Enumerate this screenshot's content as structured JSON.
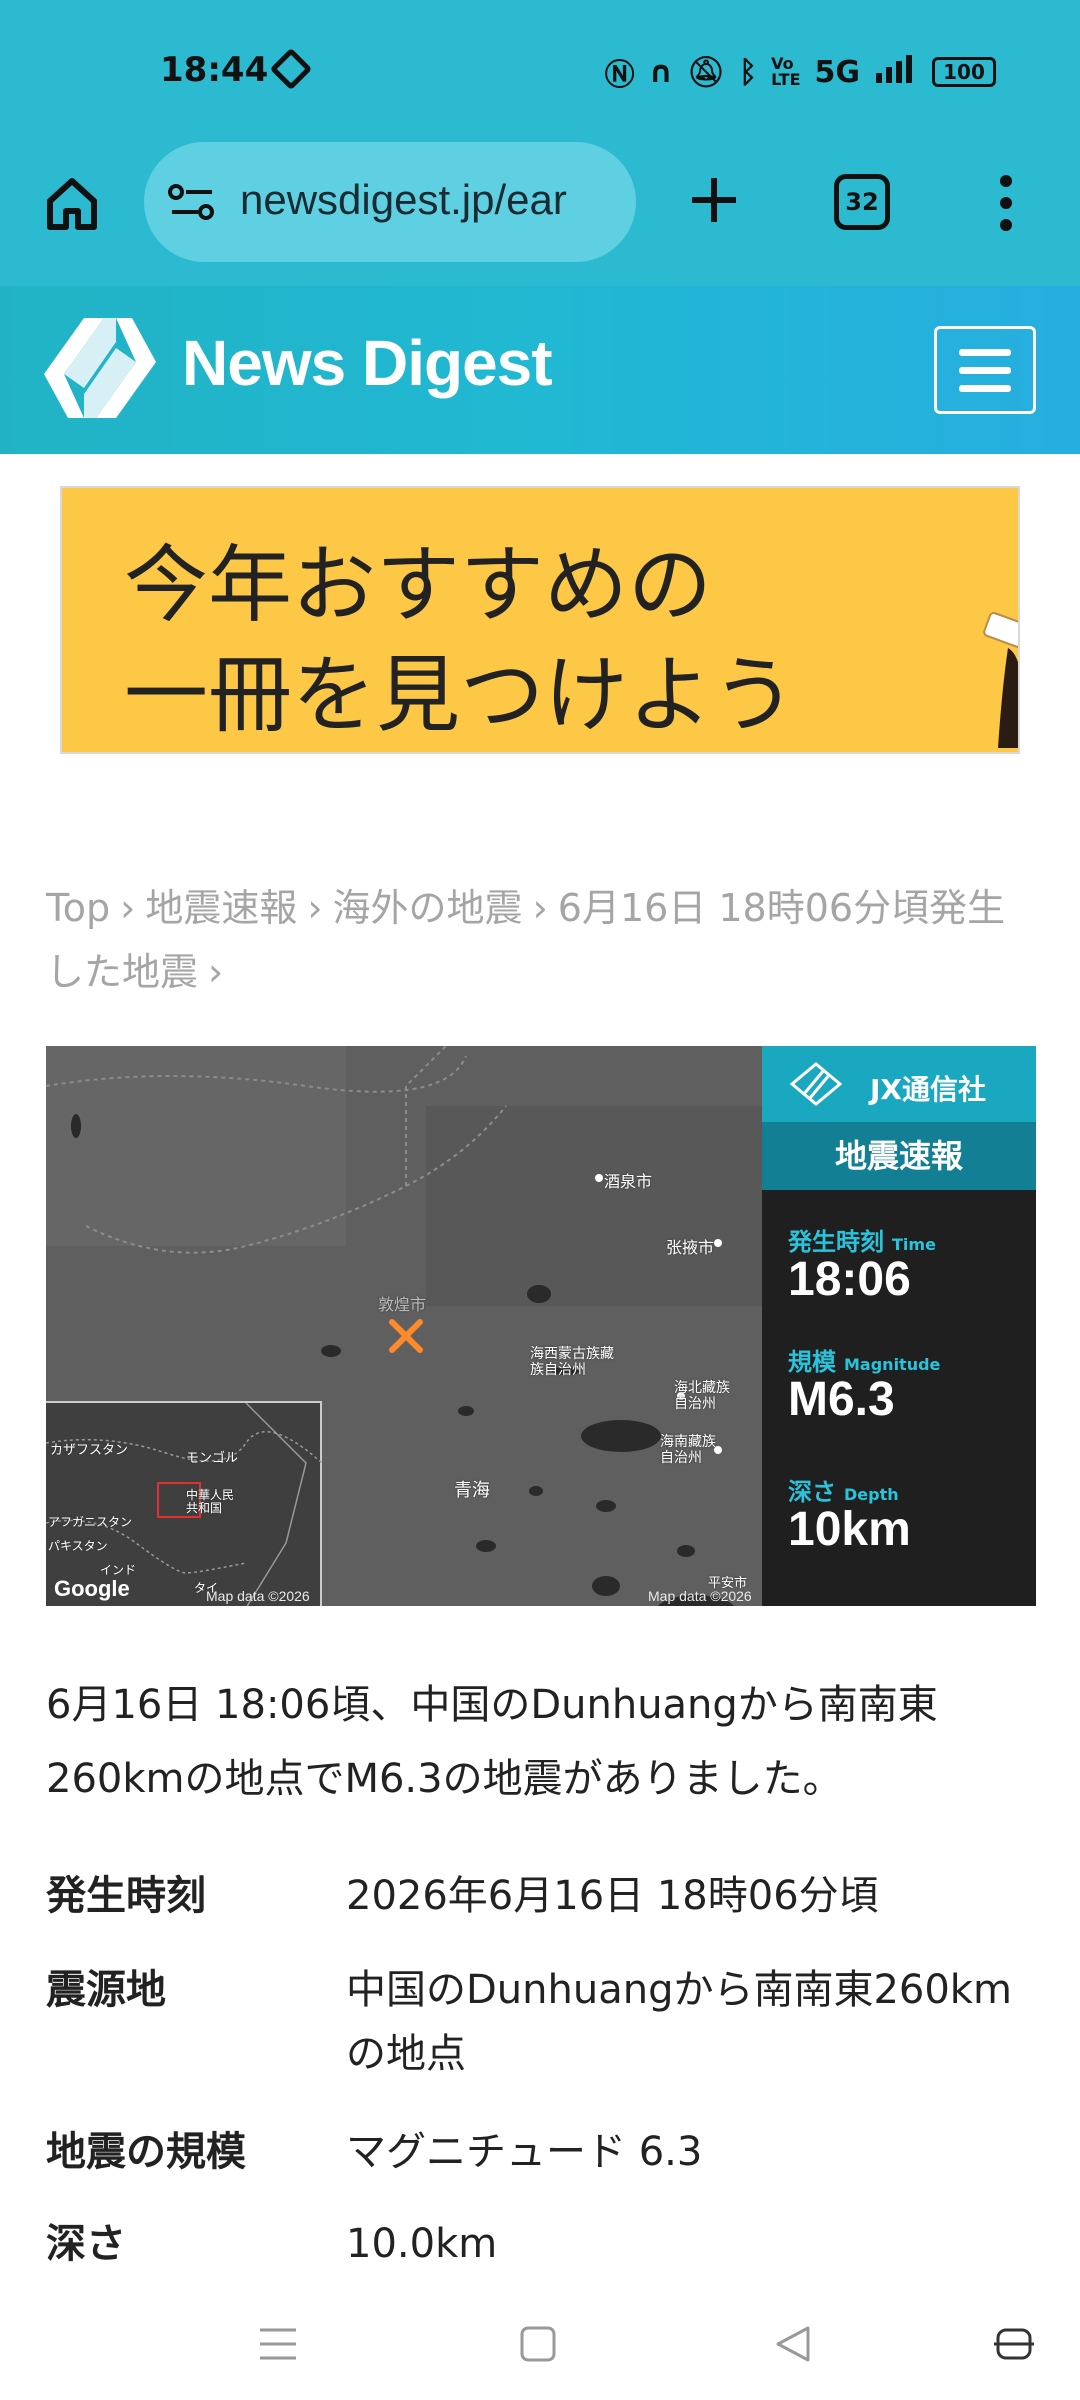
{
  "status_bar": {
    "time": "18:44",
    "network": "5G",
    "battery": "100",
    "icons": [
      "nfc-icon",
      "headphones-icon",
      "mute-icon",
      "bluetooth-icon",
      "volte-icon",
      "signal-icon"
    ]
  },
  "browser": {
    "url": "newsdigest.jp/ear",
    "tab_count": "32"
  },
  "site": {
    "name": "News Digest"
  },
  "ad": {
    "line1": "今年おすすめの",
    "line2": "一冊を見つけよう"
  },
  "breadcrumb": {
    "items": [
      "Top",
      "地震速報",
      "海外の地震",
      "6月16日 18時06分頃発生した地震"
    ],
    "separator": "›"
  },
  "map": {
    "labels": {
      "jiuquan": "酒泉市",
      "zhangye": "张掖市",
      "dunhuang_area": "敦煌市",
      "haixi": "海西蒙古族藏族自治州",
      "haibei": "海北藏族自治州",
      "hainan": "海南藏族自治州",
      "qinghai": "青海",
      "pingan": "平安市"
    },
    "inset_labels": {
      "kazakhstan": "カザフスタン",
      "mongolia": "モンゴル",
      "china": "中華人民共和国",
      "afghanistan": "アフガニスタン",
      "pakistan": "パキスタン",
      "india": "インド",
      "thailand": "タイ"
    },
    "google": "Google",
    "credit": "Map data ©2026"
  },
  "panel": {
    "brand": "JX通信社",
    "title": "地震速報",
    "time_label": "発生時刻",
    "time_label_en": "Time",
    "time_value": "18:06",
    "magnitude_label": "規模",
    "magnitude_label_en": "Magnitude",
    "magnitude_value": "M6.3",
    "depth_label": "深さ",
    "depth_label_en": "Depth",
    "depth_value": "10km"
  },
  "article": {
    "summary": "6月16日 18:06頃、中国のDunhuangから南南東260kmの地点でM6.3の地震がありました。",
    "rows": [
      {
        "key": "発生時刻",
        "value": "2026年6月16日 18時06分頃"
      },
      {
        "key": "震源地",
        "value": "中国のDunhuangから南南東260kmの地点"
      },
      {
        "key": "地震の規模",
        "value": "マグニチュード 6.3"
      },
      {
        "key": "深さ",
        "value": "10.0km"
      }
    ]
  },
  "colors": {
    "browser_bar": "#2bbad0",
    "header_start": "#21b3c5",
    "header_end": "#26aee0",
    "ad_bg": "#fcc846",
    "panel_accent": "#28c4dc",
    "quake_marker": "#ff8a2a"
  }
}
